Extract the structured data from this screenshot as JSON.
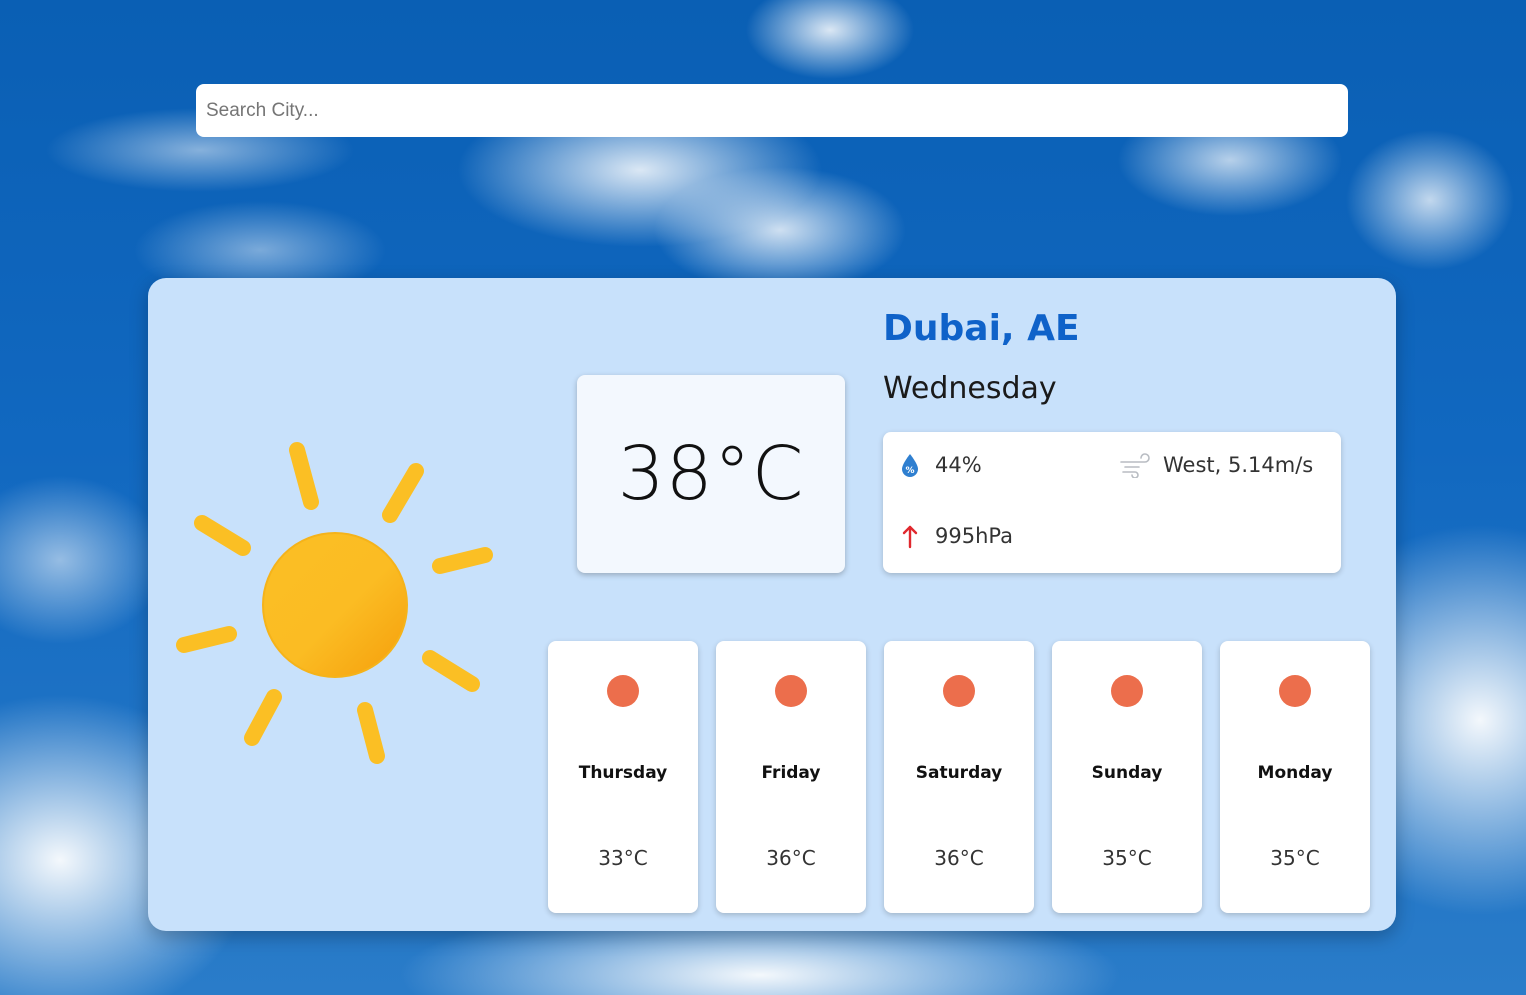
{
  "search": {
    "placeholder": "Search City...",
    "value": ""
  },
  "current": {
    "city": "Dubai, AE",
    "day": "Wednesday",
    "temperature": "38°C",
    "condition_icon": "sun-icon",
    "humidity": "44%",
    "wind": "West, 5.14m/s",
    "pressure": "995hPa"
  },
  "forecast": [
    {
      "day": "Thursday",
      "temp": "33°C",
      "icon": "sun-dot-icon"
    },
    {
      "day": "Friday",
      "temp": "36°C",
      "icon": "sun-dot-icon"
    },
    {
      "day": "Saturday",
      "temp": "36°C",
      "icon": "sun-dot-icon"
    },
    {
      "day": "Sunday",
      "temp": "35°C",
      "icon": "sun-dot-icon"
    },
    {
      "day": "Monday",
      "temp": "35°C",
      "icon": "sun-dot-icon"
    }
  ],
  "colors": {
    "card_bg": "#c8e1fb",
    "city_accent": "#0f62c9",
    "sun": "#fbbc23",
    "forecast_dot": "#ec6e4c",
    "pressure_arrow": "#e0282e",
    "humidity_drop": "#2f7fd0"
  }
}
